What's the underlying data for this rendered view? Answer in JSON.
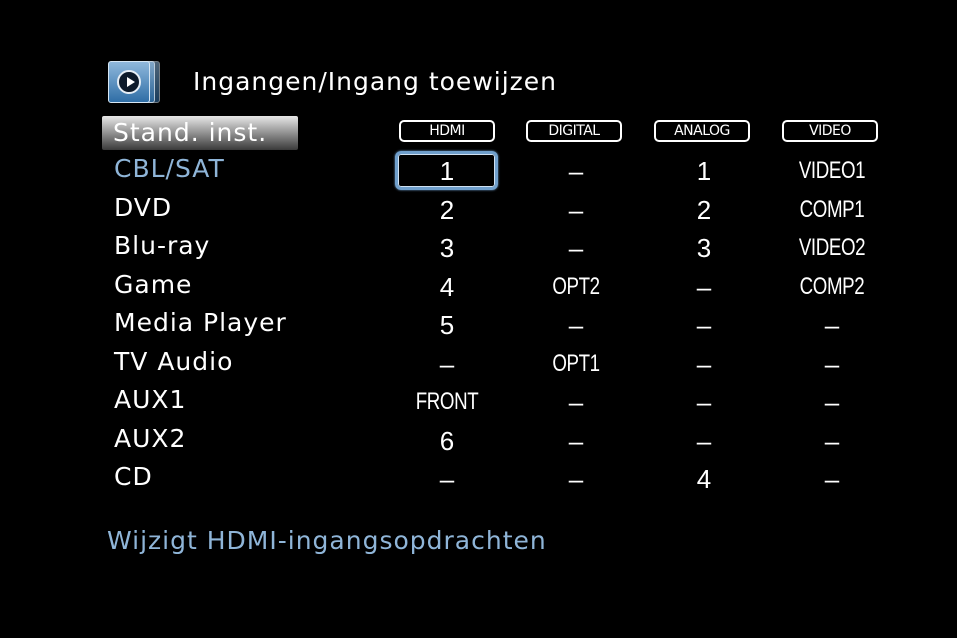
{
  "header": {
    "icon": "menu-arrow-icon",
    "title": "Ingangen/Ingang toewijzen"
  },
  "section": {
    "label": "Stand. inst."
  },
  "columns": [
    "HDMI",
    "DIGITAL",
    "ANALOG",
    "VIDEO"
  ],
  "rows": [
    {
      "source": "CBL/SAT",
      "hdmi": "1",
      "digital": "–",
      "analog": "1",
      "video": "VIDEO1"
    },
    {
      "source": "DVD",
      "hdmi": "2",
      "digital": "–",
      "analog": "2",
      "video": "COMP1"
    },
    {
      "source": "Blu-ray",
      "hdmi": "3",
      "digital": "–",
      "analog": "3",
      "video": "VIDEO2"
    },
    {
      "source": "Game",
      "hdmi": "4",
      "digital": "OPT2",
      "analog": "–",
      "video": "COMP2"
    },
    {
      "source": "Media Player",
      "hdmi": "5",
      "digital": "–",
      "analog": "–",
      "video": "–"
    },
    {
      "source": "TV Audio",
      "hdmi": "–",
      "digital": "OPT1",
      "analog": "–",
      "video": "–"
    },
    {
      "source": "AUX1",
      "hdmi": "FRONT",
      "digital": "–",
      "analog": "–",
      "video": "–"
    },
    {
      "source": "AUX2",
      "hdmi": "6",
      "digital": "–",
      "analog": "–",
      "video": "–"
    },
    {
      "source": "CD",
      "hdmi": "–",
      "digital": "–",
      "analog": "4",
      "video": "–"
    }
  ],
  "hint": "Wijzigt HDMI-ingangsopdrachten",
  "colors": {
    "background": "#000000",
    "text": "#ffffff",
    "accent": "#8fb5d8",
    "focus_border": "#6f9fcc"
  }
}
